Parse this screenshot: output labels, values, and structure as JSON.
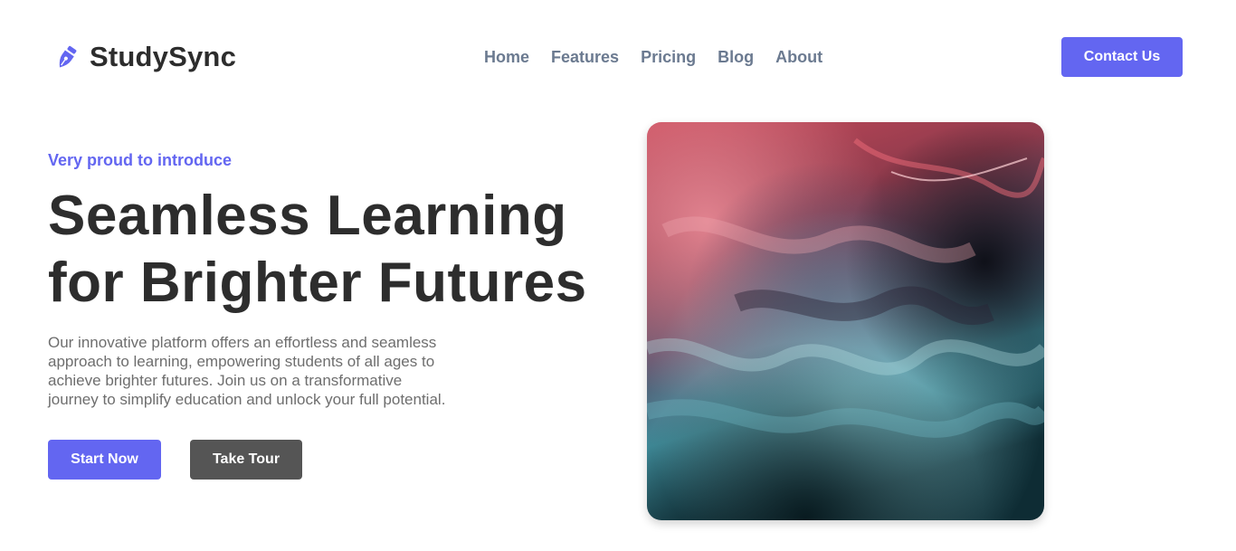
{
  "brand": {
    "name": "StudySync",
    "icon": "pen-nib-icon",
    "color": "#6366f1"
  },
  "nav": {
    "items": [
      {
        "label": "Home"
      },
      {
        "label": "Features"
      },
      {
        "label": "Pricing"
      },
      {
        "label": "Blog"
      },
      {
        "label": "About"
      }
    ],
    "cta_label": "Contact Us"
  },
  "hero": {
    "eyebrow": "Very proud to introduce",
    "title_line1": "Seamless Learning",
    "title_line2": "for Brighter Futures",
    "description_lines": [
      "Our innovative platform offers an effortless and seamless",
      "approach to learning, empowering students of all ages to",
      "achieve brighter futures. Join us on a transformative",
      "journey to simplify education and unlock your full potential."
    ],
    "primary_button": "Start Now",
    "secondary_button": "Take Tour"
  },
  "colors": {
    "accent": "#6366f1",
    "heading": "#2d2d2d",
    "nav_text": "#6b7a90",
    "body_text": "#6e6e6e",
    "secondary_button": "#555555"
  }
}
